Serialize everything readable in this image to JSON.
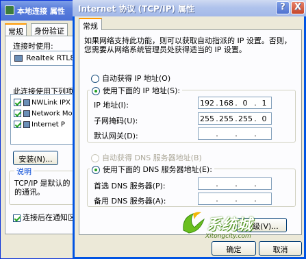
{
  "back_window": {
    "title": "本地连接 属性",
    "tabs": [
      "常规",
      "身份验证"
    ],
    "connect_using_label": "连接时使用:",
    "adapter_name": "Realtek RTL8",
    "components_label": "此连接使用下列项目",
    "components": [
      {
        "label": "NWLink IPX",
        "checked": true
      },
      {
        "label": "Network Mo",
        "checked": true
      },
      {
        "label": "Internet P",
        "checked": true
      }
    ],
    "install_button": "安装(N)...",
    "description_group_label": "说明",
    "description_lines": [
      "TCP/IP 是默认的",
      "的通讯。"
    ],
    "show_icon_label": "连接后在通知区",
    "show_icon_checked": true
  },
  "dialog": {
    "title": "Internet 协议 (TCP/IP) 属性",
    "help_button": "?",
    "close_button": "X",
    "tab": "常规",
    "description_lines": [
      "如果网络支持此功能，则可以获取自动指派的 IP 设置。否则，",
      "您需要从网络系统管理员处获得适当的 IP 设置。"
    ],
    "ip_auto_label": "自动获得 IP 地址(O)",
    "ip_manual_label": "使用下面的 IP 地址(S):",
    "ip_mode": "manual",
    "ip_address_label": "IP 地址(I):",
    "ip_address": [
      "192",
      "168",
      "0",
      "1"
    ],
    "subnet_label": "子网掩码(U):",
    "subnet_mask": [
      "255",
      "255",
      "255",
      "0"
    ],
    "gateway_label": "默认网关(D):",
    "gateway": [
      "",
      "",
      "",
      ""
    ],
    "dns_auto_label": "自动获得 DNS 服务器地址(B)",
    "dns_manual_label": "使用下面的 DNS 服务器地址(E):",
    "dns_mode": "manual",
    "preferred_dns_label": "首选 DNS 服务器(P):",
    "preferred_dns": [
      "",
      "",
      "",
      ""
    ],
    "alternate_dns_label": "备用 DNS 服务器(A):",
    "alternate_dns": [
      "",
      "",
      "",
      ""
    ],
    "advanced_button": "高级(V)...",
    "ok_button": "确定",
    "cancel_button": "取消"
  },
  "watermark": {
    "brand": "系统城",
    "url": "Xitongcity.com"
  },
  "colors": {
    "xp_face": "#ece9d8",
    "titlebar_blue": "#0054e3",
    "check_green": "#21a121",
    "group_label_blue": "#0046d5"
  }
}
